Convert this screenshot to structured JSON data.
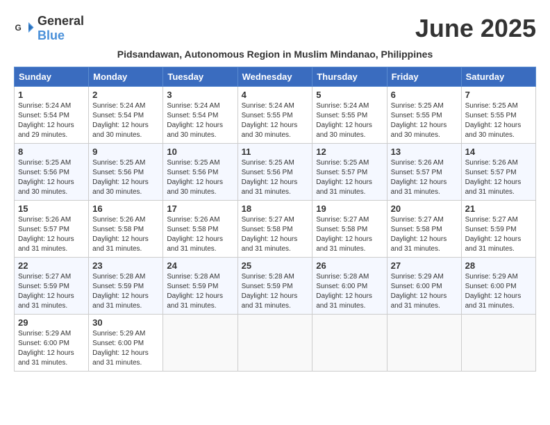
{
  "header": {
    "logo_general": "General",
    "logo_blue": "Blue",
    "month_title": "June 2025",
    "subtitle": "Pidsandawan, Autonomous Region in Muslim Mindanao, Philippines"
  },
  "days_of_week": [
    "Sunday",
    "Monday",
    "Tuesday",
    "Wednesday",
    "Thursday",
    "Friday",
    "Saturday"
  ],
  "weeks": [
    [
      {
        "day": "1",
        "sunrise": "5:24 AM",
        "sunset": "5:54 PM",
        "daylight": "12 hours and 29 minutes."
      },
      {
        "day": "2",
        "sunrise": "5:24 AM",
        "sunset": "5:54 PM",
        "daylight": "12 hours and 30 minutes."
      },
      {
        "day": "3",
        "sunrise": "5:24 AM",
        "sunset": "5:54 PM",
        "daylight": "12 hours and 30 minutes."
      },
      {
        "day": "4",
        "sunrise": "5:24 AM",
        "sunset": "5:55 PM",
        "daylight": "12 hours and 30 minutes."
      },
      {
        "day": "5",
        "sunrise": "5:24 AM",
        "sunset": "5:55 PM",
        "daylight": "12 hours and 30 minutes."
      },
      {
        "day": "6",
        "sunrise": "5:25 AM",
        "sunset": "5:55 PM",
        "daylight": "12 hours and 30 minutes."
      },
      {
        "day": "7",
        "sunrise": "5:25 AM",
        "sunset": "5:55 PM",
        "daylight": "12 hours and 30 minutes."
      }
    ],
    [
      {
        "day": "8",
        "sunrise": "5:25 AM",
        "sunset": "5:56 PM",
        "daylight": "12 hours and 30 minutes."
      },
      {
        "day": "9",
        "sunrise": "5:25 AM",
        "sunset": "5:56 PM",
        "daylight": "12 hours and 30 minutes."
      },
      {
        "day": "10",
        "sunrise": "5:25 AM",
        "sunset": "5:56 PM",
        "daylight": "12 hours and 30 minutes."
      },
      {
        "day": "11",
        "sunrise": "5:25 AM",
        "sunset": "5:56 PM",
        "daylight": "12 hours and 31 minutes."
      },
      {
        "day": "12",
        "sunrise": "5:25 AM",
        "sunset": "5:57 PM",
        "daylight": "12 hours and 31 minutes."
      },
      {
        "day": "13",
        "sunrise": "5:26 AM",
        "sunset": "5:57 PM",
        "daylight": "12 hours and 31 minutes."
      },
      {
        "day": "14",
        "sunrise": "5:26 AM",
        "sunset": "5:57 PM",
        "daylight": "12 hours and 31 minutes."
      }
    ],
    [
      {
        "day": "15",
        "sunrise": "5:26 AM",
        "sunset": "5:57 PM",
        "daylight": "12 hours and 31 minutes."
      },
      {
        "day": "16",
        "sunrise": "5:26 AM",
        "sunset": "5:58 PM",
        "daylight": "12 hours and 31 minutes."
      },
      {
        "day": "17",
        "sunrise": "5:26 AM",
        "sunset": "5:58 PM",
        "daylight": "12 hours and 31 minutes."
      },
      {
        "day": "18",
        "sunrise": "5:27 AM",
        "sunset": "5:58 PM",
        "daylight": "12 hours and 31 minutes."
      },
      {
        "day": "19",
        "sunrise": "5:27 AM",
        "sunset": "5:58 PM",
        "daylight": "12 hours and 31 minutes."
      },
      {
        "day": "20",
        "sunrise": "5:27 AM",
        "sunset": "5:58 PM",
        "daylight": "12 hours and 31 minutes."
      },
      {
        "day": "21",
        "sunrise": "5:27 AM",
        "sunset": "5:59 PM",
        "daylight": "12 hours and 31 minutes."
      }
    ],
    [
      {
        "day": "22",
        "sunrise": "5:27 AM",
        "sunset": "5:59 PM",
        "daylight": "12 hours and 31 minutes."
      },
      {
        "day": "23",
        "sunrise": "5:28 AM",
        "sunset": "5:59 PM",
        "daylight": "12 hours and 31 minutes."
      },
      {
        "day": "24",
        "sunrise": "5:28 AM",
        "sunset": "5:59 PM",
        "daylight": "12 hours and 31 minutes."
      },
      {
        "day": "25",
        "sunrise": "5:28 AM",
        "sunset": "5:59 PM",
        "daylight": "12 hours and 31 minutes."
      },
      {
        "day": "26",
        "sunrise": "5:28 AM",
        "sunset": "6:00 PM",
        "daylight": "12 hours and 31 minutes."
      },
      {
        "day": "27",
        "sunrise": "5:29 AM",
        "sunset": "6:00 PM",
        "daylight": "12 hours and 31 minutes."
      },
      {
        "day": "28",
        "sunrise": "5:29 AM",
        "sunset": "6:00 PM",
        "daylight": "12 hours and 31 minutes."
      }
    ],
    [
      {
        "day": "29",
        "sunrise": "5:29 AM",
        "sunset": "6:00 PM",
        "daylight": "12 hours and 31 minutes."
      },
      {
        "day": "30",
        "sunrise": "5:29 AM",
        "sunset": "6:00 PM",
        "daylight": "12 hours and 31 minutes."
      },
      null,
      null,
      null,
      null,
      null
    ]
  ]
}
